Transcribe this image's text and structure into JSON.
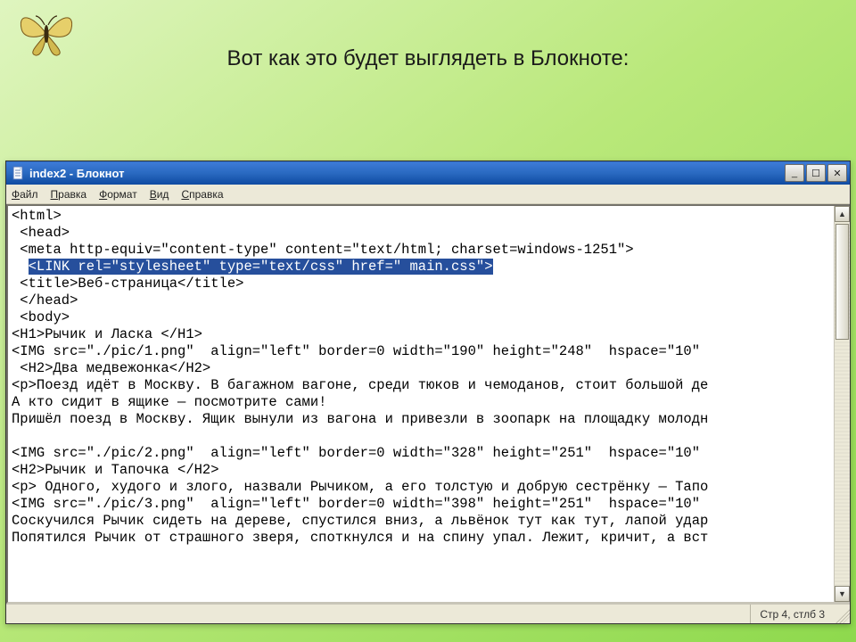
{
  "slide": {
    "heading": "Вот как это будет выглядеть в Блокноте:"
  },
  "window": {
    "title": "index2 - Блокнот",
    "menus": {
      "file": "Файл",
      "edit": "Правка",
      "format": "Формат",
      "view": "Вид",
      "help": "Справка"
    },
    "buttons": {
      "minimize": "_",
      "maximize": "☐",
      "close": "✕"
    },
    "scroll": {
      "up": "▲",
      "down": "▼"
    }
  },
  "editor": {
    "lines": [
      "<html>",
      " <head>",
      " <meta http-equiv=\"content-type\" content=\"text/html; charset=windows-1251\">",
      "  <LINK rel=\"stylesheet\" type=\"text/css\" href=\" main.css\">",
      " <title>Веб-страница</title>",
      " </head>",
      " <body>",
      "<H1>Рычик и Ласка </H1>",
      "<IMG src=\"./pic/1.png\"  align=\"left\" border=0 width=\"190\" height=\"248\"  hspace=\"10\"",
      " <H2>Два медвежонка</H2>",
      "<p>Поезд идёт в Москву. В багажном вагоне, среди тюков и чемоданов, стоит большой де",
      "А кто сидит в ящике — посмотрите сами!",
      "Пришёл поезд в Москву. Ящик вынули из вагона и привезли в зоопарк на площадку молодн",
      "",
      "<IMG src=\"./pic/2.png\"  align=\"left\" border=0 width=\"328\" height=\"251\"  hspace=\"10\"",
      "<H2>Рычик и Тапочка </H2>",
      "<p> Одного, худого и злого, назвали Рычиком, а его толстую и добрую сестрёнку — Тапо",
      "<IMG src=\"./pic/3.png\"  align=\"left\" border=0 width=\"398\" height=\"251\"  hspace=\"10\"",
      "Соскучился Рычик сидеть на дереве, спустился вниз, а львёнок тут как тут, лапой удар",
      "Попятился Рычик от страшного зверя, споткнулся и на спину упал. Лежит, кричит, а вст"
    ],
    "selected_line_index": 3
  },
  "status": {
    "position": "Стр 4, стлб 3"
  }
}
